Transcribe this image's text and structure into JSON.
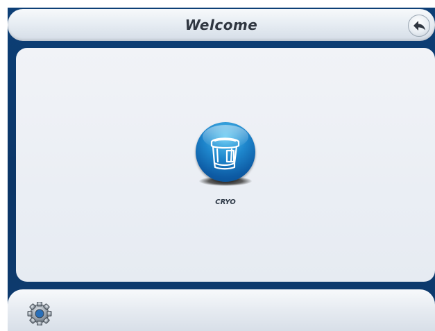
{
  "header": {
    "title": "Welcome"
  },
  "apps": [
    {
      "label": "CRYO",
      "icon": "cryo-device-icon"
    }
  ],
  "icons": {
    "back": "back-arrow-icon",
    "settings": "gear-icon"
  },
  "colors": {
    "frame": "#0b3566",
    "app_button": "#1e86cc",
    "panel": "#e6ebf2"
  }
}
